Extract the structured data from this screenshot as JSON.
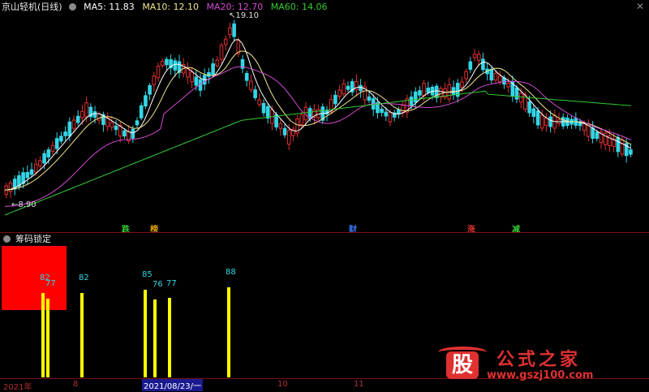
{
  "main_panel": {
    "title": "京山轻机(日线)",
    "ma": [
      {
        "label": "MA5: 11.83",
        "color": "#ffffff"
      },
      {
        "label": "MA10: 12.10",
        "color": "#f0e68c"
      },
      {
        "label": "MA20: 12.70",
        "color": "#d24bd2"
      },
      {
        "label": "MA60: 14.06",
        "color": "#33cc33"
      }
    ],
    "high_label": "19.10",
    "low_label": "8.90",
    "markers": [
      {
        "text": "跌",
        "color": "#33cc33"
      },
      {
        "text": "榜",
        "color": "#e0a000"
      },
      {
        "text": "财",
        "color": "#3a7bff"
      },
      {
        "text": "涨",
        "color": "#e03030"
      },
      {
        "text": "减",
        "color": "#33cc33"
      }
    ]
  },
  "sub_panel": {
    "title": "筹码锁定",
    "bar_labels": [
      "82",
      "77",
      "82",
      "85",
      "76",
      "77",
      "88"
    ]
  },
  "time_axis": [
    "2021年",
    "8",
    "2021/08/23/一",
    "10",
    "11"
  ],
  "watermark": {
    "logo_char": "股",
    "name": "公式之家",
    "url": "www.gszj100.com"
  },
  "colors": {
    "up": "#e03030",
    "down": "#33d6e6",
    "bar": "#ffff00",
    "red_box": "#ff0000",
    "axis": "#7a1010"
  }
}
